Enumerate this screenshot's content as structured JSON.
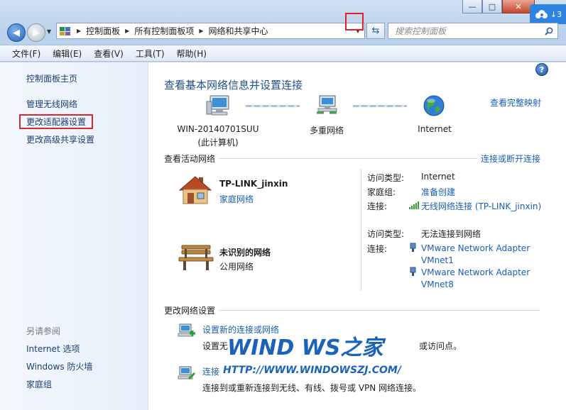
{
  "window": {
    "controls": {
      "minimize": "—",
      "maximize": "□",
      "close": "✕"
    },
    "cloud_badge": "↓3"
  },
  "address_bar": {
    "crumbs": [
      "控制面板",
      "所有控制面板项",
      "网络和共享中心"
    ],
    "search_placeholder": "搜索控制面板"
  },
  "menu": [
    "文件(F)",
    "编辑(E)",
    "查看(V)",
    "工具(T)",
    "帮助(H)"
  ],
  "left_pane": {
    "home": "控制面板主页",
    "links": [
      "管理无线网络",
      "更改适配器设置",
      "更改高级共享设置"
    ],
    "see_also_title": "另请参阅",
    "see_also": [
      "Internet 选项",
      "Windows 防火墙",
      "家庭组"
    ]
  },
  "main": {
    "title": "查看基本网络信息并设置连接",
    "full_map": "查看完整映射",
    "map": {
      "computer_name": "WIN-20140701SUU",
      "computer_sub": "(此计算机)",
      "middle": "多重网络",
      "internet": "Internet"
    },
    "active_networks": {
      "title": "查看活动网络",
      "connect_link": "连接或断开连接",
      "networks": [
        {
          "name": "TP-LINK_jinxin",
          "type": "家庭网络",
          "access_key": "访问类型:",
          "access_val": "Internet",
          "homegroup_key": "家庭组:",
          "homegroup_val": "准备创建",
          "conn_key": "连接:",
          "conn_val": "无线网络连接 (TP-LINK_jinxin)"
        },
        {
          "name": "未识别的网络",
          "type": "公用网络",
          "access_key": "访问类型:",
          "access_val": "无法连接到网络",
          "conn_key": "连接:",
          "adapters": [
            "VMware Network Adapter VMnet1",
            "VMware Network Adapter VMnet8"
          ]
        }
      ]
    },
    "change_settings": {
      "title": "更改网络设置",
      "items": [
        {
          "link": "设置新的连接或网络",
          "desc": "设置无",
          "desc_tail": "或访问点。"
        },
        {
          "link": "连接",
          "desc": "连接到或重新连接到无线、有线、拨号或 VPN 网络连接。"
        }
      ]
    }
  },
  "watermark": {
    "logo": "WIND WS之家",
    "url": "HTTP://WWW.WINDOWSZJ.COM/"
  },
  "colors": {
    "link": "#1a5eb4",
    "title": "#1f4f8f",
    "highlight_box": "#e0202a"
  }
}
